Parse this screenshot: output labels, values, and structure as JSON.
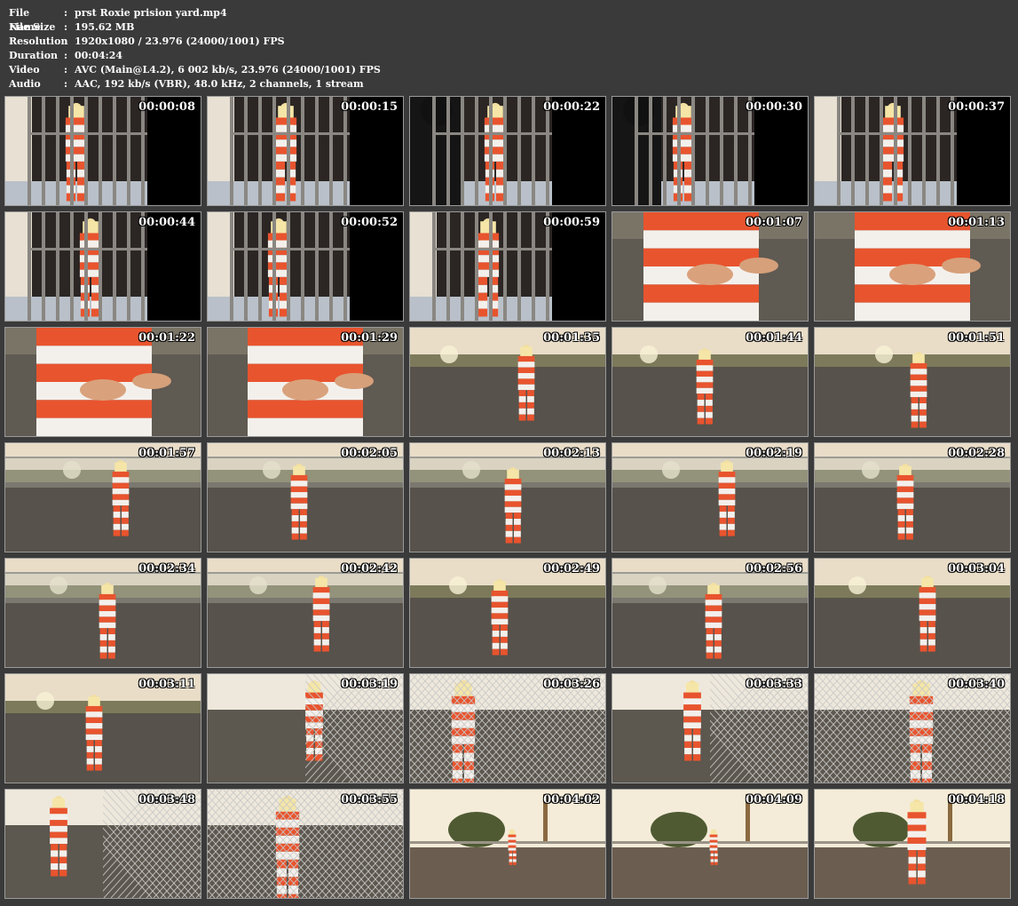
{
  "info": [
    {
      "label": "File Name",
      "value": "prst Roxie prision yard.mp4"
    },
    {
      "label": "File Size",
      "value": "195.62 MB"
    },
    {
      "label": "Resolution",
      "value": "1920x1080 / 23.976 (24000/1001) FPS"
    },
    {
      "label": "Duration",
      "value": "00:04:24"
    },
    {
      "label": "Video",
      "value": "AVC (Main@L4.2), 6 002 kb/s, 23.976 (24000/1001) FPS"
    },
    {
      "label": "Audio",
      "value": "AAC, 192 kb/s (VBR), 48.0 kHz, 2 channels, 1 stream"
    }
  ],
  "separator": ":",
  "thumbnails": [
    {
      "time": "00:00:08",
      "scene": "cell"
    },
    {
      "time": "00:00:15",
      "scene": "cell"
    },
    {
      "time": "00:00:22",
      "scene": "cell-guard"
    },
    {
      "time": "00:00:30",
      "scene": "cell-guard"
    },
    {
      "time": "00:00:37",
      "scene": "cell"
    },
    {
      "time": "00:00:44",
      "scene": "cell"
    },
    {
      "time": "00:00:52",
      "scene": "cell"
    },
    {
      "time": "00:00:59",
      "scene": "cell-close"
    },
    {
      "time": "00:01:07",
      "scene": "closeup"
    },
    {
      "time": "00:01:13",
      "scene": "closeup"
    },
    {
      "time": "00:01:22",
      "scene": "closeup"
    },
    {
      "time": "00:01:29",
      "scene": "closeup-yard"
    },
    {
      "time": "00:01:35",
      "scene": "yard"
    },
    {
      "time": "00:01:44",
      "scene": "yard"
    },
    {
      "time": "00:01:51",
      "scene": "yard"
    },
    {
      "time": "00:01:57",
      "scene": "yard-fence"
    },
    {
      "time": "00:02:05",
      "scene": "yard-fence"
    },
    {
      "time": "00:02:13",
      "scene": "yard-fence"
    },
    {
      "time": "00:02:19",
      "scene": "yard-fence"
    },
    {
      "time": "00:02:28",
      "scene": "yard-fence"
    },
    {
      "time": "00:02:34",
      "scene": "yard-fence"
    },
    {
      "time": "00:02:42",
      "scene": "yard-fence"
    },
    {
      "time": "00:02:49",
      "scene": "yard"
    },
    {
      "time": "00:02:56",
      "scene": "yard-fence"
    },
    {
      "time": "00:03:04",
      "scene": "yard"
    },
    {
      "time": "00:03:11",
      "scene": "yard"
    },
    {
      "time": "00:03:19",
      "scene": "chainlink"
    },
    {
      "time": "00:03:26",
      "scene": "chainlink"
    },
    {
      "time": "00:03:33",
      "scene": "chainlink"
    },
    {
      "time": "00:03:40",
      "scene": "chainlink"
    },
    {
      "time": "00:03:48",
      "scene": "chainlink"
    },
    {
      "time": "00:03:55",
      "scene": "chainlink"
    },
    {
      "time": "00:04:02",
      "scene": "sunset"
    },
    {
      "time": "00:04:09",
      "scene": "sunset"
    },
    {
      "time": "00:04:18",
      "scene": "sunset"
    }
  ]
}
